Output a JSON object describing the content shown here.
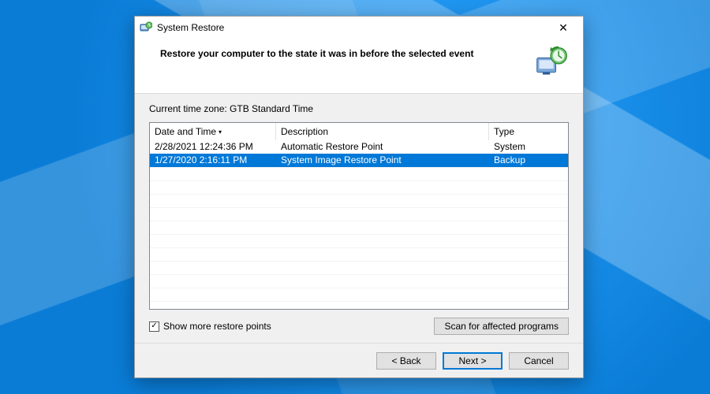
{
  "window": {
    "title": "System Restore",
    "heading": "Restore your computer to the state it was in before the selected event"
  },
  "timezone_line": "Current time zone: GTB Standard Time",
  "columns": {
    "date": "Date and Time",
    "desc": "Description",
    "type": "Type",
    "sorted": "date",
    "sort_dir": "desc"
  },
  "rows": [
    {
      "date": "2/28/2021 12:24:36 PM",
      "desc": "Automatic Restore Point",
      "type": "System",
      "selected": false
    },
    {
      "date": "1/27/2020 2:16:11 PM",
      "desc": "System Image Restore Point",
      "type": "Backup",
      "selected": true
    }
  ],
  "show_more": {
    "label": "Show more restore points",
    "checked": true
  },
  "buttons": {
    "scan": "Scan for affected programs",
    "back": "< Back",
    "next": "Next >",
    "cancel": "Cancel"
  }
}
